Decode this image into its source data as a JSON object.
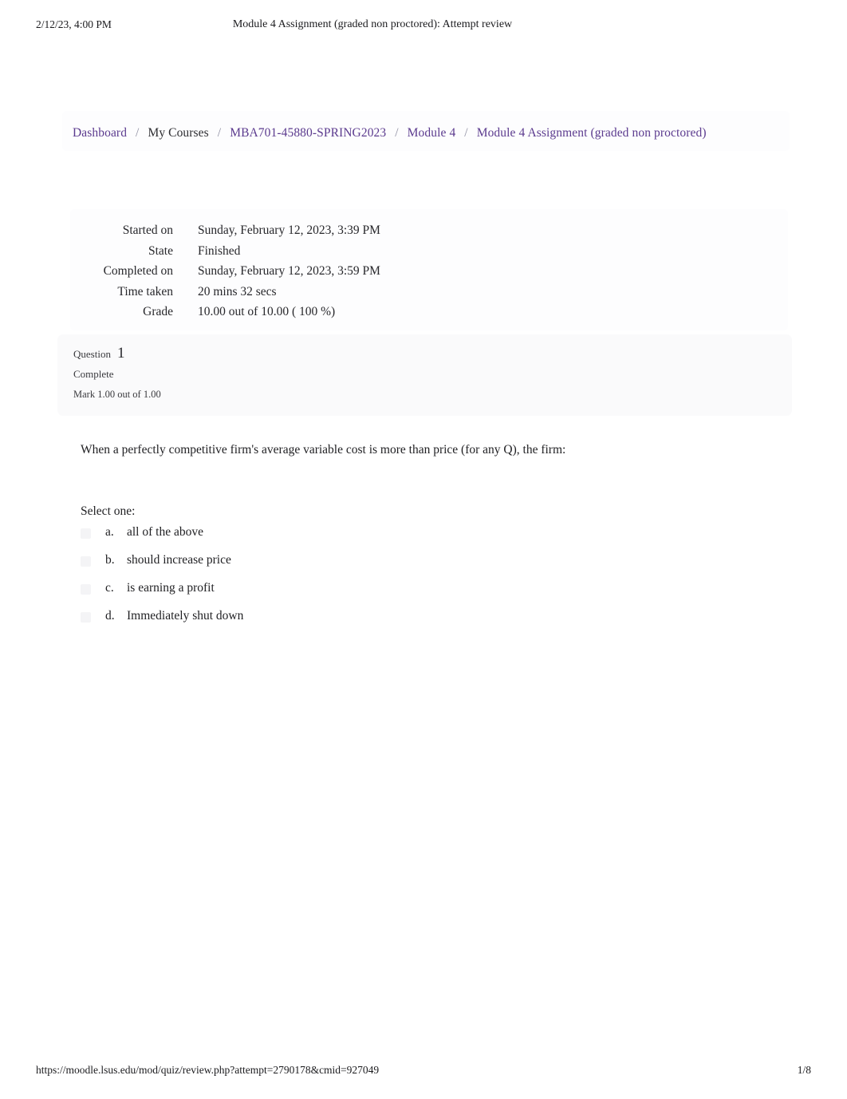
{
  "print_header": {
    "date": "2/12/23, 4:00 PM",
    "title": "Module 4 Assignment (graded non proctored): Attempt review"
  },
  "breadcrumb": {
    "separator": "/",
    "items": [
      {
        "label": "Dashboard",
        "is_link": true
      },
      {
        "label": "My Courses",
        "is_link": false
      },
      {
        "label": "MBA701-45880-SPRING2023",
        "is_link": true
      },
      {
        "label": "Module 4",
        "is_link": true
      },
      {
        "label": "Module 4 Assignment (graded non proctored)",
        "is_link": true
      }
    ],
    "link_color": "#5b3a8e"
  },
  "attempt_summary": {
    "rows": [
      {
        "key": "Started on",
        "value": "Sunday, February 12, 2023, 3:39 PM"
      },
      {
        "key": "State",
        "value": "Finished"
      },
      {
        "key": "Completed on",
        "value": "Sunday, February 12, 2023, 3:59 PM"
      },
      {
        "key": "Time taken",
        "value": "20 mins 32 secs"
      },
      {
        "key": "Grade",
        "value": "10.00  out of 10.00 (  100 %)"
      }
    ]
  },
  "question": {
    "number_label": "Question",
    "number": "1",
    "state": "Complete",
    "mark": "Mark 1.00 out of 1.00",
    "text": "When a perfectly competitive firm's average variable cost is more than price (for any Q), the firm:",
    "select_prompt": "Select one:",
    "options": [
      {
        "letter": "a.",
        "text": "all of the above"
      },
      {
        "letter": "b.",
        "text": "should increase price"
      },
      {
        "letter": "c.",
        "text": "is earning a profit"
      },
      {
        "letter": "d.",
        "text": "Immediately shut down"
      }
    ]
  },
  "print_footer": {
    "url": "https://moodle.lsus.edu/mod/quiz/review.php?attempt=2790178&cmid=927049",
    "page": "1/8"
  }
}
